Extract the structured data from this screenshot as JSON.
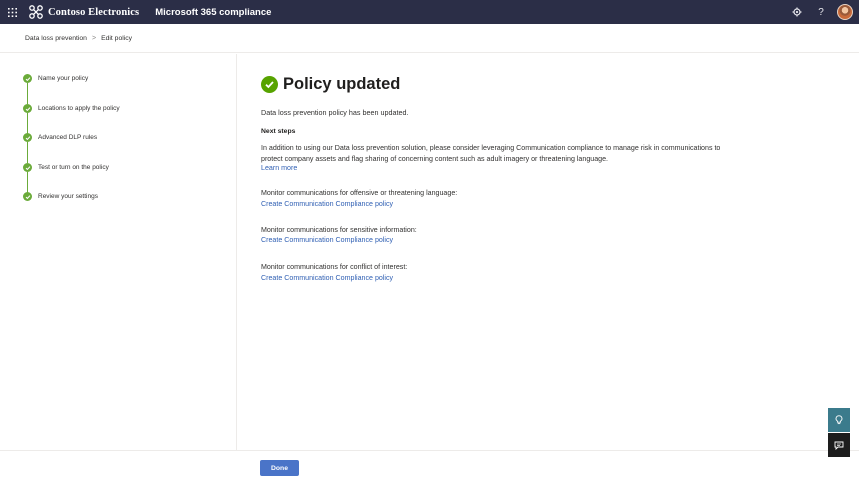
{
  "topbar": {
    "org_name": "Contoso Electronics",
    "app_name": "Microsoft 365 compliance",
    "settings_icon": "gear-icon",
    "help_label": "?",
    "bg_color": "#2b2e47"
  },
  "breadcrumb": {
    "items": [
      "Data loss prevention",
      "Edit policy"
    ],
    "separator": ">"
  },
  "steps": [
    {
      "label": "Name your policy",
      "status": "complete"
    },
    {
      "label": "Locations to apply the policy",
      "status": "complete"
    },
    {
      "label": "Advanced DLP rules",
      "status": "complete"
    },
    {
      "label": "Test or turn on the policy",
      "status": "complete"
    },
    {
      "label": "Review your settings",
      "status": "complete"
    }
  ],
  "main": {
    "title": "Policy updated",
    "subtitle": "Data loss prevention policy has been updated.",
    "next_steps_heading": "Next steps",
    "paragraph": "In addition to using our Data loss prevention solution, please consider leveraging Communication compliance to manage risk in communications to protect company assets and flag sharing of concerning content such as adult imagery or threatening language.",
    "learn_more": "Learn more",
    "monitors": [
      {
        "text": "Monitor communications for offensive or threatening language:",
        "link": "Create Communication Compliance policy"
      },
      {
        "text": "Monitor communications for sensitive information:",
        "link": "Create Communication Compliance policy"
      },
      {
        "text": "Monitor communications for conflict of interest:",
        "link": "Create Communication Compliance policy"
      }
    ]
  },
  "footer": {
    "done_label": "Done"
  },
  "colors": {
    "accent": "#4a74c8",
    "success": "#57a300",
    "link": "#2f5fb3"
  }
}
